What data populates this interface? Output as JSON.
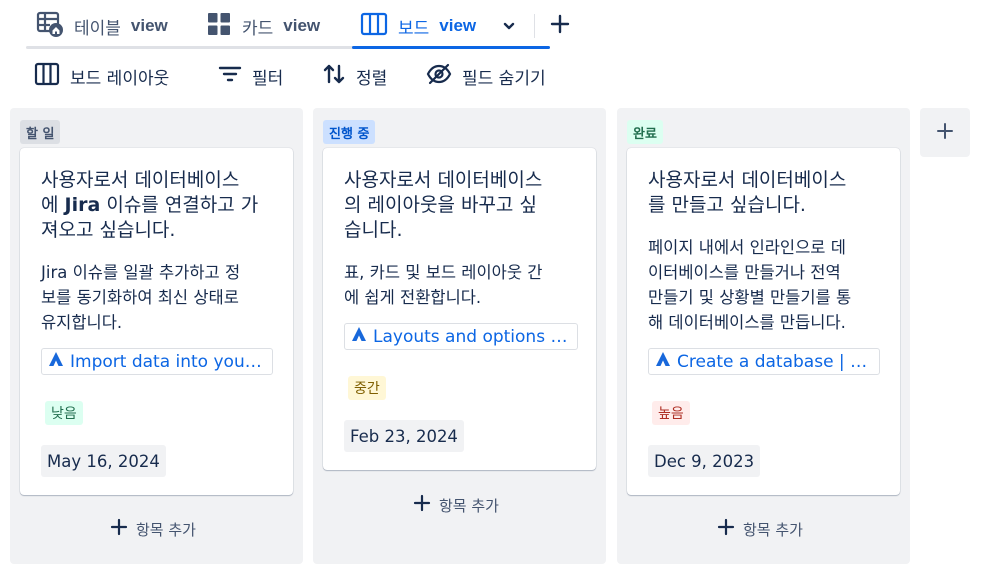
{
  "views": {
    "tabs": [
      {
        "label_ko": "테이블",
        "label_en": "view",
        "icon": "table-home-icon"
      },
      {
        "label_ko": "카드",
        "label_en": "view",
        "icon": "card-grid-icon"
      },
      {
        "label_ko": "보드",
        "label_en": "view",
        "icon": "board-columns-icon",
        "active": true
      }
    ],
    "add_icon": "plus-icon"
  },
  "toolbar": {
    "layout_label": "보드 레이아웃",
    "filter_label": "필터",
    "sort_label": "정렬",
    "hide_fields_label": "필드 숨기기"
  },
  "board": {
    "add_item_label": "항목 추가",
    "columns": [
      {
        "status": "할 일",
        "card": {
          "title": "사용자로서 데이터베이스\n에 Jira 이슈를 연결하고 가\n져오고 싶습니다.",
          "description": "Jira 이슈를 일괄 추가하고 정\n보를 동기화하여 최신 상태로\n유지합니다.",
          "link": "Import data into your da...",
          "priority": "낮음",
          "date": "May 16, 2024"
        }
      },
      {
        "status": "진행 중",
        "card": {
          "title": "사용자로서 데이터베이스\n의 레이아웃을 바꾸고 싶\n습니다.",
          "description": "표, 카드 및 보드 레이아웃 간\n에 쉽게 전환합니다.",
          "link": "Layouts and options | C...",
          "priority": "중간",
          "date": "Feb 23, 2024"
        }
      },
      {
        "status": "완료",
        "card": {
          "title": "사용자로서 데이터베이스\n를 만들고 싶습니다.",
          "description": "페이지 내에서 인라인으로 데\n이터베이스를 만들거나 전역\n만들기 및 상황별 만들기를 통\n해 데이터베이스를 만듭니다.",
          "link": "Create a database | Conf...",
          "priority": "높음",
          "date": "Dec 9, 2023"
        }
      }
    ]
  },
  "colors": {
    "accent": "#0c66e4",
    "column_bg": "#f1f2f4",
    "text": "#172b4d",
    "subtle_text": "#44546f"
  }
}
